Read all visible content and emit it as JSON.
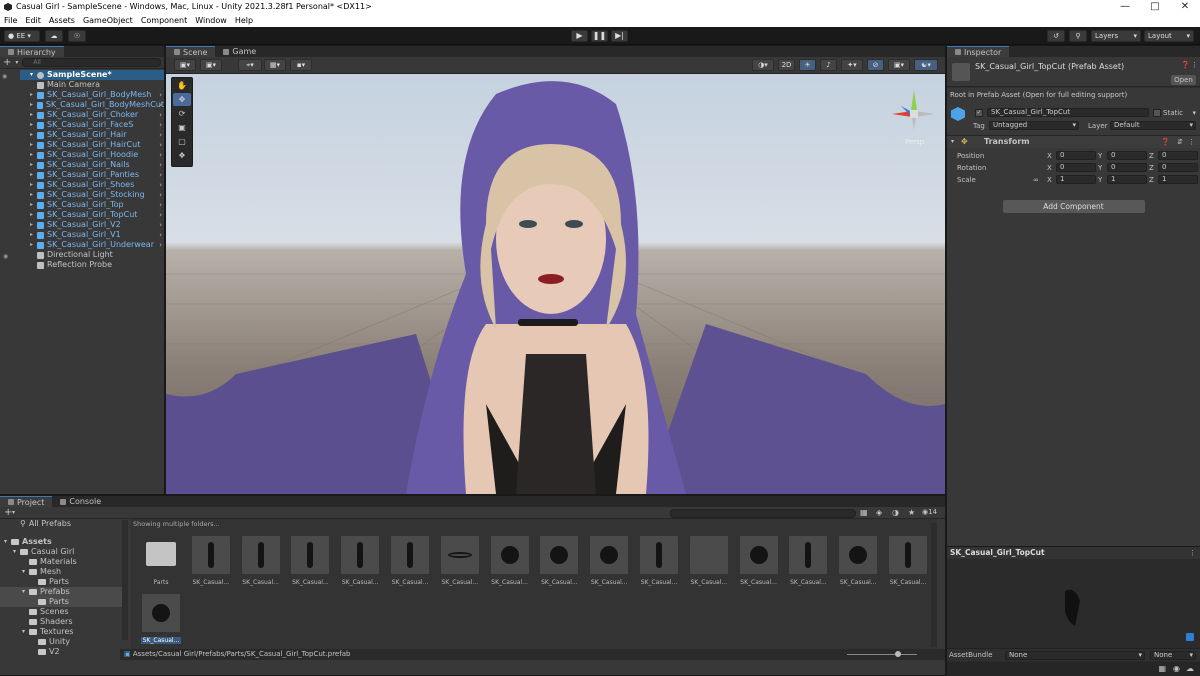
{
  "window": {
    "title": "Casual Girl - SampleScene - Windows, Mac, Linux - Unity 2021.3.28f1 Personal* <DX11>"
  },
  "menu": [
    "File",
    "Edit",
    "Assets",
    "GameObject",
    "Component",
    "Window",
    "Help"
  ],
  "toolbar": {
    "account": "EE",
    "layers": "Layers",
    "layout": "Layout"
  },
  "hierarchy": {
    "tab": "Hierarchy",
    "search_placeholder": "All",
    "scene": "SampleScene*",
    "items": [
      {
        "label": "Main Camera",
        "prefab": false,
        "arrow": false
      },
      {
        "label": "SK_Casual_Girl_BodyMesh",
        "prefab": true,
        "arrow": true
      },
      {
        "label": "SK_Casual_Girl_BodyMeshCut",
        "prefab": true,
        "arrow": true
      },
      {
        "label": "SK_Casual_Girl_Choker",
        "prefab": true,
        "arrow": true
      },
      {
        "label": "SK_Casual_Girl_FaceS",
        "prefab": true,
        "arrow": true
      },
      {
        "label": "SK_Casual_Girl_Hair",
        "prefab": true,
        "arrow": true
      },
      {
        "label": "SK_Casual_Girl_HairCut",
        "prefab": true,
        "arrow": true
      },
      {
        "label": "SK_Casual_Girl_Hoodie",
        "prefab": true,
        "arrow": true
      },
      {
        "label": "SK_Casual_Girl_Nails",
        "prefab": true,
        "arrow": true
      },
      {
        "label": "SK_Casual_Girl_Panties",
        "prefab": true,
        "arrow": true
      },
      {
        "label": "SK_Casual_Girl_Shoes",
        "prefab": true,
        "arrow": true
      },
      {
        "label": "SK_Casual_Girl_Stocking",
        "prefab": true,
        "arrow": true
      },
      {
        "label": "SK_Casual_Girl_Top",
        "prefab": true,
        "arrow": true
      },
      {
        "label": "SK_Casual_Girl_TopCut",
        "prefab": true,
        "arrow": true
      },
      {
        "label": "SK_Casual_Girl_V2",
        "prefab": true,
        "arrow": true
      },
      {
        "label": "SK_Casual_Girl_V1",
        "prefab": true,
        "arrow": true
      },
      {
        "label": "SK_Casual_Girl_Underwear",
        "prefab": true,
        "arrow": true
      },
      {
        "label": "Directional Light",
        "prefab": false,
        "arrow": false
      },
      {
        "label": "Reflection Probe",
        "prefab": false,
        "arrow": false
      }
    ]
  },
  "scene": {
    "tab_scene": "Scene",
    "tab_game": "Game",
    "mode_2d": "2D",
    "persp": "Persp"
  },
  "inspector": {
    "tab": "Inspector",
    "asset_title": "SK_Casual_Girl_TopCut (Prefab Asset)",
    "open_button": "Open",
    "root_note": "Root in Prefab Asset (Open for full editing support)",
    "object_name": "SK_Casual_Girl_TopCut",
    "static_label": "Static",
    "tag_label": "Tag",
    "tag_value": "Untagged",
    "layer_label": "Layer",
    "layer_value": "Default",
    "transform_label": "Transform",
    "rows": [
      {
        "label": "Position",
        "x": "0",
        "y": "0",
        "z": "0"
      },
      {
        "label": "Rotation",
        "x": "0",
        "y": "0",
        "z": "0"
      },
      {
        "label": "Scale",
        "x": "1",
        "y": "1",
        "z": "1"
      }
    ],
    "axis_x": "X",
    "axis_y": "Y",
    "axis_z": "Z",
    "add_component": "Add Component"
  },
  "preview": {
    "title": "SK_Casual_Girl_TopCut",
    "assetbundle_label": "AssetBundle",
    "assetbundle_value": "None",
    "variant_value": "None"
  },
  "project": {
    "tab_project": "Project",
    "tab_console": "Console",
    "showing": "Showing multiple folders...",
    "count": "14",
    "all_prefabs": "All Prefabs",
    "tree": [
      {
        "label": "Assets",
        "indent": 0,
        "bold": true
      },
      {
        "label": "Casual Girl",
        "indent": 1
      },
      {
        "label": "Materials",
        "indent": 2
      },
      {
        "label": "Mesh",
        "indent": 2
      },
      {
        "label": "Parts",
        "indent": 3
      },
      {
        "label": "Prefabs",
        "indent": 2,
        "selected": true
      },
      {
        "label": "Parts",
        "indent": 3,
        "selected": true
      },
      {
        "label": "Scenes",
        "indent": 2
      },
      {
        "label": "Shaders",
        "indent": 2
      },
      {
        "label": "Textures",
        "indent": 2
      },
      {
        "label": "Unity",
        "indent": 3
      },
      {
        "label": "V2",
        "indent": 3
      }
    ],
    "assets": [
      "Parts",
      "SK_Casual...",
      "SK_Casual...",
      "SK_Casual...",
      "SK_Casual...",
      "SK_Casual...",
      "SK_Casual...",
      "SK_Casual...",
      "SK_Casual...",
      "SK_Casual...",
      "SK_Casual...",
      "SK_Casual...",
      "SK_Casual...",
      "SK_Casual...",
      "SK_Casual...",
      "SK_Casual...",
      "SK_Casual..."
    ],
    "path": "Assets/Casual Girl/Prefabs/Parts/SK_Casual_Girl_TopCut.prefab"
  }
}
